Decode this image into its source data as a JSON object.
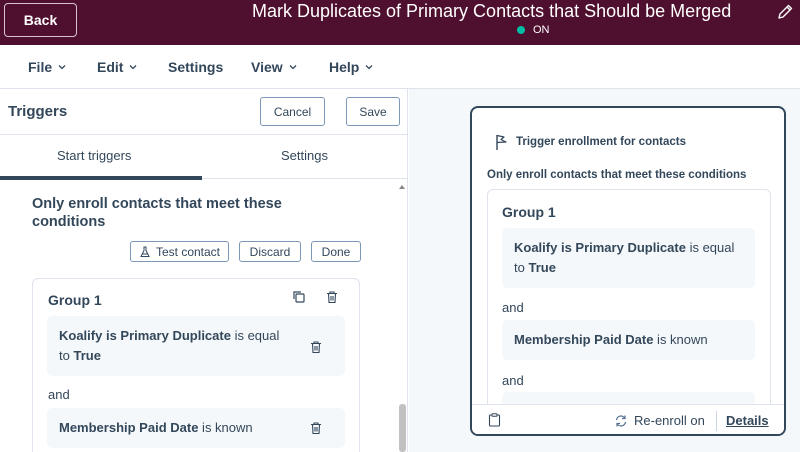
{
  "header": {
    "back_label": "Back",
    "workflow_title": "Mark Duplicates of Primary Contacts that Should be Merged",
    "status": "ON",
    "status_color": "#00bda5",
    "brand_color": "#4f0f2e"
  },
  "menu": {
    "file": "File",
    "edit": "Edit",
    "settings": "Settings",
    "view": "View",
    "help": "Help"
  },
  "panel": {
    "title": "Triggers",
    "cancel_label": "Cancel",
    "save_label": "Save",
    "tab_start": "Start triggers",
    "tab_settings": "Settings",
    "conditions_heading": "Only enroll contacts that meet these conditions",
    "test_contact_label": "Test contact",
    "discard_label": "Discard",
    "done_label": "Done",
    "group_title": "Group 1",
    "cond1_property": "Koalify is Primary Duplicate",
    "cond1_op": " is equal",
    "cond1_to": "to ",
    "cond1_value": "True",
    "and_label": "and",
    "cond2_property": "Membership Paid Date",
    "cond2_op": " is known"
  },
  "card": {
    "title": "Trigger enrollment for contacts",
    "subtitle": "Only enroll contacts that meet these conditions",
    "group_title": "Group 1",
    "cond1_property": "Koalify is Primary Duplicate",
    "cond1_op": " is equal",
    "cond1_to": "to ",
    "cond1_value": "True",
    "and_label_1": "and",
    "cond2_property": "Membership Paid Date",
    "cond2_op": " is known",
    "and_label_2": "and",
    "reenroll_label": "Re-enroll on",
    "details_label": "Details"
  }
}
